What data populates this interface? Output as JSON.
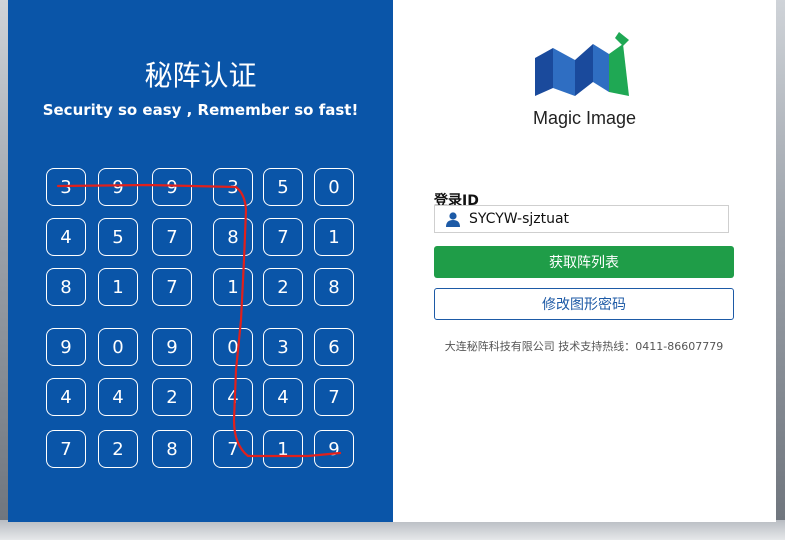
{
  "left": {
    "title_cn": "秘阵认证",
    "subtitle": "Security so easy , Remember so fast!",
    "grid": [
      [
        "3",
        "9",
        "9",
        "3",
        "5",
        "0"
      ],
      [
        "4",
        "5",
        "7",
        "8",
        "7",
        "1"
      ],
      [
        "8",
        "1",
        "7",
        "1",
        "2",
        "8"
      ],
      [
        "9",
        "0",
        "9",
        "0",
        "3",
        "6"
      ],
      [
        "4",
        "4",
        "2",
        "4",
        "4",
        "7"
      ],
      [
        "7",
        "2",
        "8",
        "7",
        "1",
        "9"
      ]
    ],
    "trace_color": "#e0201c"
  },
  "right": {
    "logo_text": "Magic Image",
    "id_label": "登录ID",
    "id_value": "SYCYW-sjztuat",
    "get_matrix_button": "获取阵列表",
    "change_password_button": "修改图形密码",
    "footer": "大连秘阵科技有限公司 技术支持热线：0411-86607779"
  },
  "colors": {
    "left_bg": "#0a55a8",
    "primary_button": "#1f9d48",
    "secondary_border": "#1d5aa6"
  }
}
